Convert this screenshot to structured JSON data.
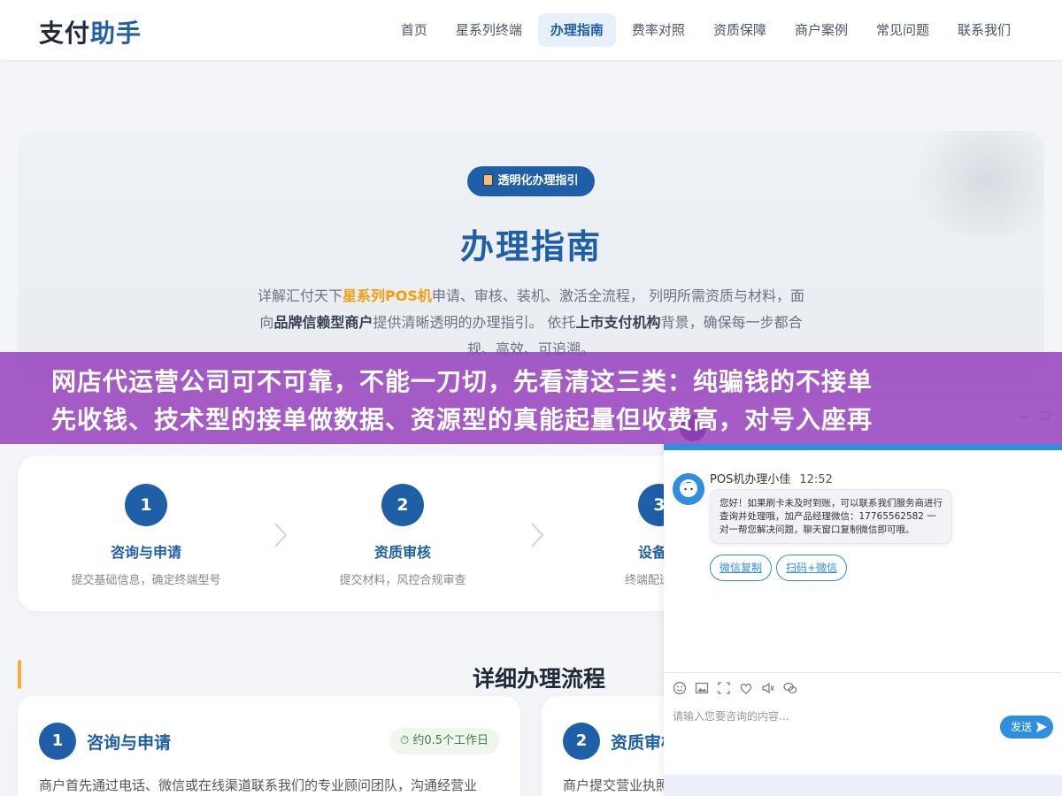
{
  "header": {
    "logo_part1": "支付",
    "logo_part2": "助手",
    "nav": [
      {
        "label": "首页",
        "active": false
      },
      {
        "label": "星系列终端",
        "active": false
      },
      {
        "label": "办理指南",
        "active": true
      },
      {
        "label": "费率对照",
        "active": false
      },
      {
        "label": "资质保障",
        "active": false
      },
      {
        "label": "商户案例",
        "active": false
      },
      {
        "label": "常见问题",
        "active": false
      },
      {
        "label": "联系我们",
        "active": false
      }
    ]
  },
  "hero": {
    "badge": "透明化办理指引",
    "title": "办理指南",
    "desc": {
      "p1": "详解汇付天下",
      "hl1": "星系列POS机",
      "p2": "申请、审核、装机、激活全流程， 列明所需资质与材料，面向",
      "hl2": "品牌信赖型商户",
      "p3": "提供清晰透明的办理指引。 依托",
      "hl3": "上市支付机构",
      "p4": "背景，确保每一步都合规、高效、可追溯。"
    }
  },
  "overlay_banner": {
    "line1": "网店代运营公司可不可靠，不能一刀切，先看清这三类：纯骗钱的不接单",
    "line2": "先收钱、技术型的接单做数据、资源型的真能起量但收费高，对号入座再"
  },
  "steps": [
    {
      "num": "1",
      "title": "咨询与申请",
      "sub": "提交基础信息，确定终端型号"
    },
    {
      "num": "2",
      "title": "资质审核",
      "sub": "提交材料，风控合规审查"
    },
    {
      "num": "3",
      "title": "设备装",
      "sub": "终端配送与现"
    }
  ],
  "detail": {
    "title": "详细办理流程",
    "cards": [
      {
        "num": "1",
        "title": "咨询与申请",
        "tag": "约0.5个工作日",
        "text": "商户首先通过电话、微信或在线渠道联系我们的专业顾问团队，沟通经营业"
      },
      {
        "num": "2",
        "title": "资质审核",
        "text": "商户提交营业执照"
      }
    ]
  },
  "chat": {
    "agent_name": "POS机办理小佳",
    "time": "12:52",
    "message": "您好！如果刷卡未及时到账，可以联系我们服务商进行查询并处理哦，加产品经理微信：17765562582 一对一帮您解决问题，聊天窗口复制微信即可哦。",
    "btn_copy": "微信复制",
    "btn_scan": "扫码+微信",
    "input_placeholder": "请输入您要咨询的内容...",
    "send_label": "发送"
  },
  "colors": {
    "brand_blue": "#1e5fa8",
    "accent_orange": "#f59e0b",
    "overlay_purple": "#9641be",
    "chat_blue": "#2f8ee0"
  }
}
